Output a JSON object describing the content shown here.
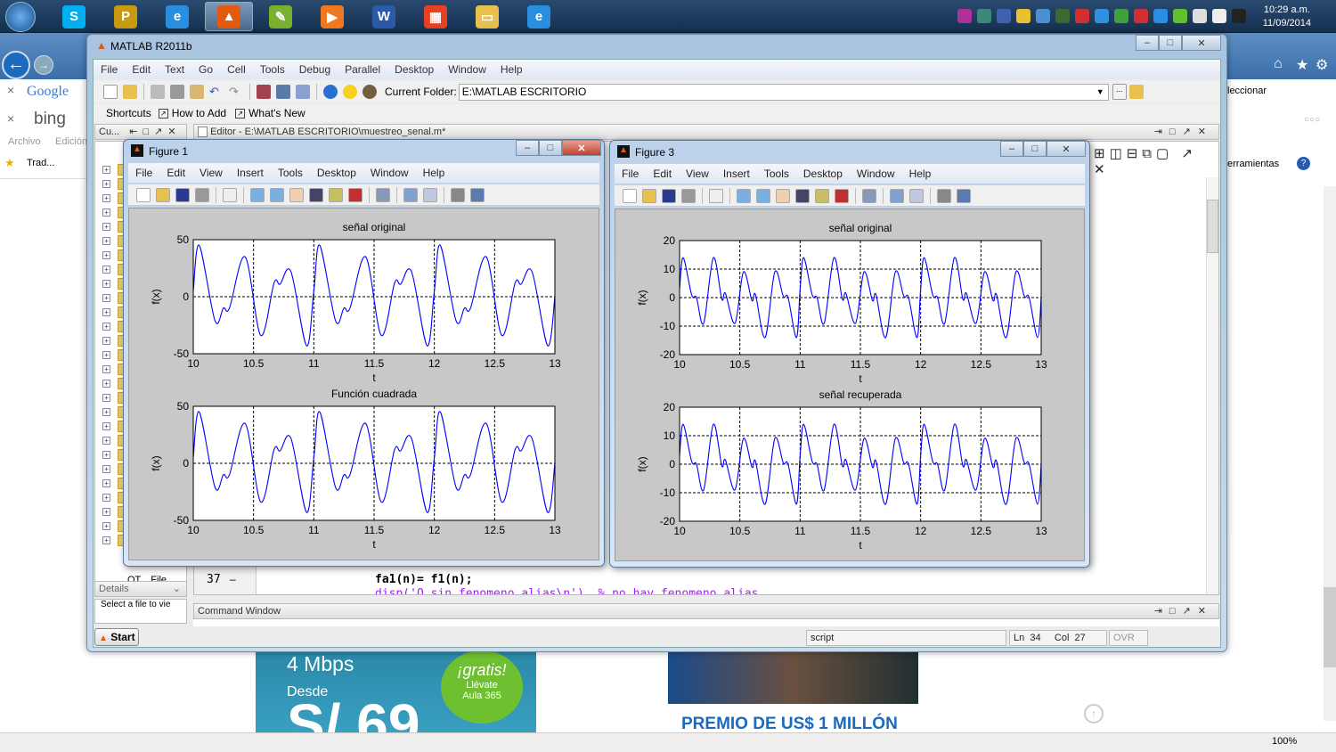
{
  "taskbar": {
    "apps": [
      {
        "icon": "skype-icon",
        "glyph": "S",
        "color": "#00aff0"
      },
      {
        "icon": "prime-icon",
        "glyph": "P",
        "color": "#c89a10"
      },
      {
        "icon": "internet-explorer-icon",
        "glyph": "e",
        "color": "#2a8ee0"
      },
      {
        "icon": "matlab-icon",
        "glyph": "▲",
        "color": "#e05a10"
      },
      {
        "icon": "green-app-icon",
        "glyph": "✎",
        "color": "#7ab030"
      },
      {
        "icon": "media-player-icon",
        "glyph": "▶",
        "color": "#f07820"
      },
      {
        "icon": "word-icon",
        "glyph": "W",
        "color": "#2a5aa8"
      },
      {
        "icon": "apps-grid-icon",
        "glyph": "▦",
        "color": "#e84020"
      },
      {
        "icon": "file-explorer-icon",
        "glyph": "▭",
        "color": "#e8c050"
      },
      {
        "icon": "internet-explorer-icon",
        "glyph": "e",
        "color": "#2a8ee0"
      }
    ],
    "tray_colors": [
      "#b0309a",
      "#3a8a7a",
      "#4060b0",
      "#e8c030",
      "#4a90d0",
      "#3a6a30",
      "#d03030",
      "#3090e0",
      "#40a040",
      "#d03030",
      "#2a8ee0",
      "#60c030",
      "#ddd",
      "#eee",
      "#222"
    ],
    "clock_time": "10:29 a.m.",
    "clock_date": "11/09/2014"
  },
  "browser": {
    "google": "Google",
    "bing": "bing",
    "menu_archivo": "Archivo",
    "menu_edicion": "Edición",
    "fav_trad": "Trad...",
    "seleccionar": "leccionar",
    "herramientas": "erramientas",
    "zoom": "100%",
    "ad1_speed": "4 Mbps",
    "ad1_desde": "Desde",
    "ad1_price": "S/ 69",
    "ad1_badge_title": "¡gratis!",
    "ad1_badge_line1": "Llévate",
    "ad1_badge_line2": "Aula 365",
    "ad2_headline": "PREMIO DE US$ 1 MILLÓN"
  },
  "matlab": {
    "title": "MATLAB  R2011b",
    "menu": [
      "File",
      "Edit",
      "Text",
      "Go",
      "Cell",
      "Tools",
      "Debug",
      "Parallel",
      "Desktop",
      "Window",
      "Help"
    ],
    "current_folder_label": "Current Folder:",
    "current_folder_value": "E:\\MATLAB ESCRITORIO",
    "shortcuts": "Shortcuts",
    "how_to_add": "How to Add",
    "whats_new": "What's New",
    "folder_panel_title": "Cu...",
    "folder_bottom_item": "OT... File...",
    "details": "Details",
    "select_file": "Select a file to vie",
    "editor_title": "Editor - E:\\MATLAB ESCRITORIO\\muestreo_senal.m*",
    "editor_line_number": "37",
    "editor_line_code": "fa1(n)= f1(n);",
    "editor_next_line": "disp('O sin fenomeno alias\\n')  % no hay fenomeno alias",
    "command_window": "Command Window",
    "start": "Start",
    "status_mode": "script",
    "ln_label": "Ln",
    "ln": "34",
    "col_label": "Col",
    "col": "27",
    "ovr": "OVR"
  },
  "figures": [
    {
      "title": "Figure 1",
      "menu": [
        "File",
        "Edit",
        "View",
        "Insert",
        "Tools",
        "Desktop",
        "Window",
        "Help"
      ]
    },
    {
      "title": "Figure 3",
      "menu": [
        "File",
        "Edit",
        "View",
        "Insert",
        "Tools",
        "Desktop",
        "Window",
        "Help"
      ]
    }
  ],
  "chart_data": [
    {
      "type": "line",
      "figure": "Figure 1",
      "title": "señal original",
      "xlabel": "t",
      "ylabel": "f(x)",
      "xlim": [
        10,
        13
      ],
      "ylim": [
        -50,
        50
      ],
      "xticks": [
        "10",
        "10.5",
        "11",
        "11.5",
        "12",
        "12.5",
        "13"
      ],
      "yticks": [
        "-50",
        "0",
        "50"
      ],
      "grid": true,
      "color": "#0000ff",
      "x": [
        10,
        10.05,
        10.18,
        10.25,
        10.3,
        10.43,
        10.56,
        10.67,
        10.72,
        10.81,
        10.94,
        11,
        11.05,
        11.18,
        11.25,
        11.3,
        11.43,
        11.56,
        11.67,
        11.72,
        11.81,
        11.94,
        12,
        12.05,
        12.18,
        12.25,
        12.3,
        12.43,
        12.56,
        12.67,
        12.72,
        12.81,
        12.94,
        13
      ],
      "y": [
        5,
        45,
        -21,
        -10,
        -10,
        35,
        -34,
        12,
        11,
        22,
        -43,
        5,
        45,
        -21,
        -10,
        -10,
        35,
        -34,
        12,
        11,
        22,
        -43,
        5,
        45,
        -21,
        -10,
        -10,
        35,
        -34,
        12,
        11,
        22,
        -43,
        0
      ]
    },
    {
      "type": "line",
      "figure": "Figure 1",
      "title": "Función cuadrada",
      "xlabel": "t",
      "ylabel": "f(x)",
      "xlim": [
        10,
        13
      ],
      "ylim": [
        -50,
        50
      ],
      "xticks": [
        "10",
        "10.5",
        "11",
        "11.5",
        "12",
        "12.5",
        "13"
      ],
      "yticks": [
        "-50",
        "0",
        "50"
      ],
      "grid": true,
      "color": "#0000ff",
      "x": [
        10,
        10.05,
        10.18,
        10.25,
        10.3,
        10.43,
        10.56,
        10.67,
        10.72,
        10.81,
        10.94,
        11,
        11.05,
        11.18,
        11.25,
        11.3,
        11.43,
        11.56,
        11.67,
        11.72,
        11.81,
        11.94,
        12,
        12.05,
        12.18,
        12.25,
        12.3,
        12.43,
        12.56,
        12.67,
        12.72,
        12.81,
        12.94,
        13
      ],
      "y": [
        5,
        45,
        -21,
        -10,
        -10,
        35,
        -34,
        12,
        11,
        22,
        -43,
        5,
        45,
        -21,
        -10,
        -10,
        35,
        -34,
        12,
        11,
        22,
        -43,
        5,
        45,
        -21,
        -10,
        -10,
        35,
        -34,
        12,
        11,
        22,
        -43,
        0
      ]
    },
    {
      "type": "line",
      "figure": "Figure 3",
      "title": "señal original",
      "xlabel": "t",
      "ylabel": "f(x)",
      "xlim": [
        10,
        13
      ],
      "ylim": [
        -20,
        20
      ],
      "xticks": [
        "10",
        "10.5",
        "11",
        "11.5",
        "12",
        "12.5",
        "13"
      ],
      "yticks": [
        "-20",
        "-10",
        "0",
        "10",
        "20"
      ],
      "grid": true,
      "color": "#0000ff",
      "x": [
        10,
        10.03,
        10.1,
        10.14,
        10.2,
        10.28,
        10.35,
        10.38,
        10.46,
        10.53,
        10.6,
        10.63,
        10.71,
        10.79,
        10.86,
        10.9,
        10.97,
        11,
        11.03,
        11.1,
        11.14,
        11.2,
        11.28,
        11.35,
        11.38,
        11.46,
        11.53,
        11.6,
        11.63,
        11.71,
        11.79,
        11.86,
        11.9,
        11.97,
        12,
        12.03,
        12.1,
        12.14,
        12.2,
        12.28,
        12.35,
        12.38,
        12.46,
        12.53,
        12.6,
        12.63,
        12.71,
        12.79,
        12.86,
        12.9,
        12.97,
        13
      ],
      "y": [
        3,
        14,
        1,
        0,
        -9,
        14,
        -0.5,
        1.5,
        -9,
        9,
        -1,
        1,
        -14,
        9,
        0.5,
        0,
        -14,
        3,
        14,
        1,
        0,
        -9,
        14,
        -0.5,
        1.5,
        -9,
        9,
        -1,
        1,
        -14,
        9,
        0.5,
        0,
        -14,
        3,
        14,
        1,
        0,
        -9,
        14,
        -0.5,
        1.5,
        -9,
        9,
        -1,
        1,
        -14,
        9,
        0.5,
        0,
        -14,
        0
      ]
    },
    {
      "type": "line",
      "figure": "Figure 3",
      "title": "señal recuperada",
      "xlabel": "t",
      "ylabel": "f(x)",
      "xlim": [
        10,
        13
      ],
      "ylim": [
        -20,
        20
      ],
      "xticks": [
        "10",
        "10.5",
        "11",
        "11.5",
        "12",
        "12.5",
        "13"
      ],
      "yticks": [
        "-20",
        "-10",
        "0",
        "10",
        "20"
      ],
      "grid": true,
      "color": "#0000ff",
      "x": [
        10,
        10.03,
        10.1,
        10.14,
        10.2,
        10.28,
        10.35,
        10.38,
        10.46,
        10.53,
        10.6,
        10.63,
        10.71,
        10.79,
        10.86,
        10.9,
        10.97,
        11,
        11.03,
        11.1,
        11.14,
        11.2,
        11.28,
        11.35,
        11.38,
        11.46,
        11.53,
        11.6,
        11.63,
        11.71,
        11.79,
        11.86,
        11.9,
        11.97,
        12,
        12.03,
        12.1,
        12.14,
        12.2,
        12.28,
        12.35,
        12.38,
        12.46,
        12.53,
        12.6,
        12.63,
        12.71,
        12.79,
        12.86,
        12.9,
        12.97,
        13
      ],
      "y": [
        3,
        14,
        1,
        0,
        -9,
        14,
        -0.5,
        1.5,
        -9,
        9,
        -1,
        1,
        -14,
        9,
        0.5,
        0,
        -14,
        3,
        14,
        1,
        0,
        -9,
        14,
        -0.5,
        1.5,
        -9,
        9,
        -1,
        1,
        -14,
        9,
        0.5,
        0,
        -14,
        3,
        14,
        1,
        0,
        -9,
        14,
        -0.5,
        1.5,
        -9,
        9,
        -1,
        1,
        -14,
        9,
        0.5,
        0,
        -14,
        0
      ]
    }
  ]
}
